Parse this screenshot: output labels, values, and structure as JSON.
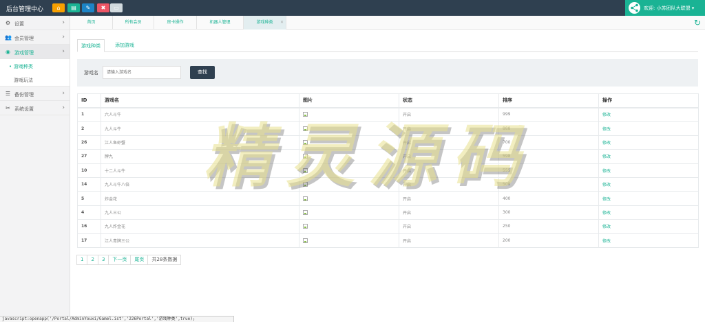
{
  "app": {
    "title": "后台管理中心"
  },
  "toolbar": {
    "buttons": [
      {
        "icon": "home-icon",
        "glyph": "⌂",
        "color": "#f7a000"
      },
      {
        "icon": "list-icon",
        "glyph": "▤",
        "color": "#1ab394"
      },
      {
        "icon": "edit-icon",
        "glyph": "✎",
        "color": "#1c84c6"
      },
      {
        "icon": "delete-icon",
        "glyph": "✖",
        "color": "#ed5565"
      },
      {
        "icon": "window-icon",
        "glyph": "▭",
        "color": "#d1dade"
      }
    ]
  },
  "user": {
    "greeting": "欢迎: 小苏团队大联盟 ▾"
  },
  "sidebar": {
    "items": [
      {
        "label": "设置",
        "icon": "gears-icon",
        "glyph": "⚙"
      },
      {
        "label": "会员管理",
        "icon": "users-icon",
        "glyph": "👥"
      },
      {
        "label": "游戏管理",
        "icon": "globe-icon",
        "glyph": "◉"
      },
      {
        "label": "备份管理",
        "icon": "database-icon",
        "glyph": "☰"
      },
      {
        "label": "系统设置",
        "icon": "wrench-icon",
        "glyph": "✂"
      }
    ],
    "sub_items": [
      {
        "label": "游戏种类"
      },
      {
        "label": "游戏玩法"
      }
    ]
  },
  "page_tabs": [
    "首页",
    "所有会员",
    "房卡操作",
    "机器人管理",
    "游戏种类"
  ],
  "content": {
    "tabs": [
      "游戏种类",
      "添加游戏"
    ],
    "search": {
      "label": "游戏名",
      "placeholder": "请输入游戏名",
      "button": "查找"
    },
    "table": {
      "headers": [
        "ID",
        "游戏名",
        "图片",
        "状态",
        "排序",
        "操作"
      ],
      "rows": [
        {
          "id": "1",
          "name": "六人斗牛",
          "status": "开启",
          "sort": "999",
          "action": "修改"
        },
        {
          "id": "2",
          "name": "九人斗牛",
          "status": "开启",
          "sort": "888",
          "action": "修改"
        },
        {
          "id": "26",
          "name": "江人鱼虾蟹",
          "status": "开启",
          "sort": "700",
          "action": "修改"
        },
        {
          "id": "27",
          "name": "牌九",
          "status": "开启",
          "sort": "598",
          "action": "修改"
        },
        {
          "id": "10",
          "name": "十二人斗牛",
          "status": "开启",
          "sort": "555",
          "action": "修改"
        },
        {
          "id": "14",
          "name": "九人斗牛八倍",
          "status": "开启",
          "sort": "500",
          "action": "修改"
        },
        {
          "id": "5",
          "name": "炸金花",
          "status": "开启",
          "sort": "400",
          "action": "修改"
        },
        {
          "id": "4",
          "name": "九人三公",
          "status": "开启",
          "sort": "300",
          "action": "修改"
        },
        {
          "id": "16",
          "name": "九人炸金花",
          "status": "开启",
          "sort": "250",
          "action": "修改"
        },
        {
          "id": "17",
          "name": "江人青牌三公",
          "status": "开启",
          "sort": "200",
          "action": "修改"
        }
      ]
    },
    "pager": [
      "1",
      "2",
      "3",
      "下一页",
      "尾页",
      "共28条数据"
    ]
  },
  "watermark": "精灵源码",
  "status_url": "javascript:openapp('/Portal/AdminYouxi/Gamel.ist','226Portal','游戏种类',true);"
}
